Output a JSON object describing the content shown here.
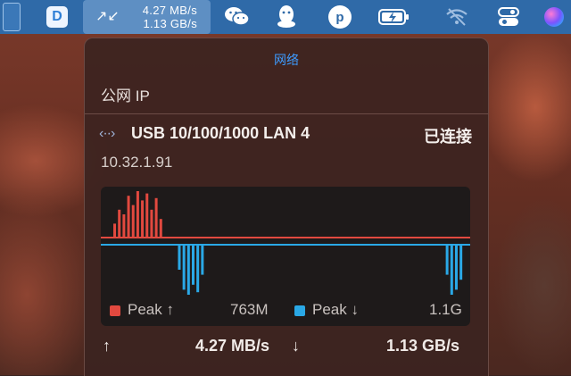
{
  "menubar": {
    "netstat": {
      "arrows": "↗↙",
      "up": "4.27 MB/s",
      "down": "1.13 GB/s"
    },
    "icons": [
      "window-icon",
      "app-logo-icon",
      "wechat-icon",
      "qq-icon",
      "p-icon",
      "battery-icon",
      "wifi-icon",
      "control-center-icon",
      "siri-icon"
    ],
    "app_logo_letter": "D",
    "p_letter": "p"
  },
  "panel": {
    "title": "网络",
    "public_ip_label": "公网 IP",
    "interface": {
      "icon": "‹··›",
      "name": "USB 10/100/1000 LAN 4",
      "status": "已连接",
      "ip": "10.32.1.91"
    },
    "legend": {
      "upload_label": "Peak ↑",
      "upload_value": "763M",
      "download_label": "Peak ↓",
      "download_value": "1.1G",
      "upload_color": "#e2493f",
      "download_color": "#2aa8e6"
    },
    "footer": {
      "up_arrow": "↑",
      "up_value": "4.27 MB/s",
      "down_arrow": "↓",
      "down_value": "1.13 GB/s"
    }
  },
  "chart_data": {
    "type": "area",
    "upload": [
      0,
      0,
      0,
      0.3,
      0.6,
      0.5,
      0.9,
      0.7,
      1.0,
      0.8,
      0.95,
      0.6,
      0.85,
      0.4,
      0,
      0,
      0,
      0,
      0,
      0,
      0,
      0,
      0,
      0,
      0,
      0,
      0,
      0,
      0,
      0,
      0,
      0,
      0,
      0,
      0,
      0,
      0,
      0,
      0,
      0,
      0,
      0,
      0,
      0,
      0,
      0,
      0,
      0,
      0,
      0,
      0,
      0,
      0,
      0,
      0,
      0,
      0,
      0,
      0,
      0,
      0,
      0,
      0,
      0,
      0,
      0,
      0,
      0,
      0,
      0,
      0,
      0,
      0,
      0,
      0,
      0,
      0,
      0,
      0,
      0,
      0
    ],
    "download": [
      0,
      0,
      0,
      0,
      0,
      0,
      0,
      0,
      0,
      0,
      0,
      0,
      0,
      0,
      0,
      0,
      0,
      0.5,
      0.9,
      1.0,
      0.8,
      0.95,
      0.6,
      0,
      0,
      0,
      0,
      0,
      0,
      0,
      0,
      0,
      0,
      0,
      0,
      0,
      0,
      0,
      0,
      0,
      0,
      0,
      0,
      0,
      0,
      0,
      0,
      0,
      0,
      0,
      0,
      0,
      0,
      0,
      0,
      0,
      0,
      0,
      0,
      0,
      0,
      0,
      0,
      0,
      0,
      0,
      0,
      0,
      0,
      0,
      0,
      0,
      0,
      0,
      0,
      0.6,
      1.0,
      0.9,
      0.7,
      0,
      0
    ]
  }
}
